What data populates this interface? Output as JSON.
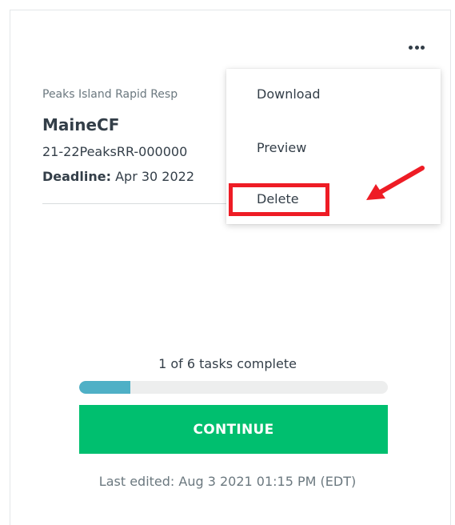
{
  "card": {
    "org_name": "Peaks Island Rapid Resp",
    "title": "MaineCF",
    "reference": "21-22PeaksRR-000000",
    "deadline_label": "Deadline:",
    "deadline_value": "Apr 30 2022"
  },
  "menu": {
    "items": [
      {
        "label": "Download"
      },
      {
        "label": "Preview"
      },
      {
        "label": "Delete"
      }
    ]
  },
  "progress": {
    "text": "1 of 6 tasks complete",
    "completed": 1,
    "total": 6
  },
  "continue_label": "CONTINUE",
  "last_edited": "Last edited: Aug 3 2021 01:15 PM (EDT)",
  "colors": {
    "accent_green": "#00bf6f",
    "progress_blue": "#4fb0c6",
    "annotation_red": "#ee1c25"
  }
}
